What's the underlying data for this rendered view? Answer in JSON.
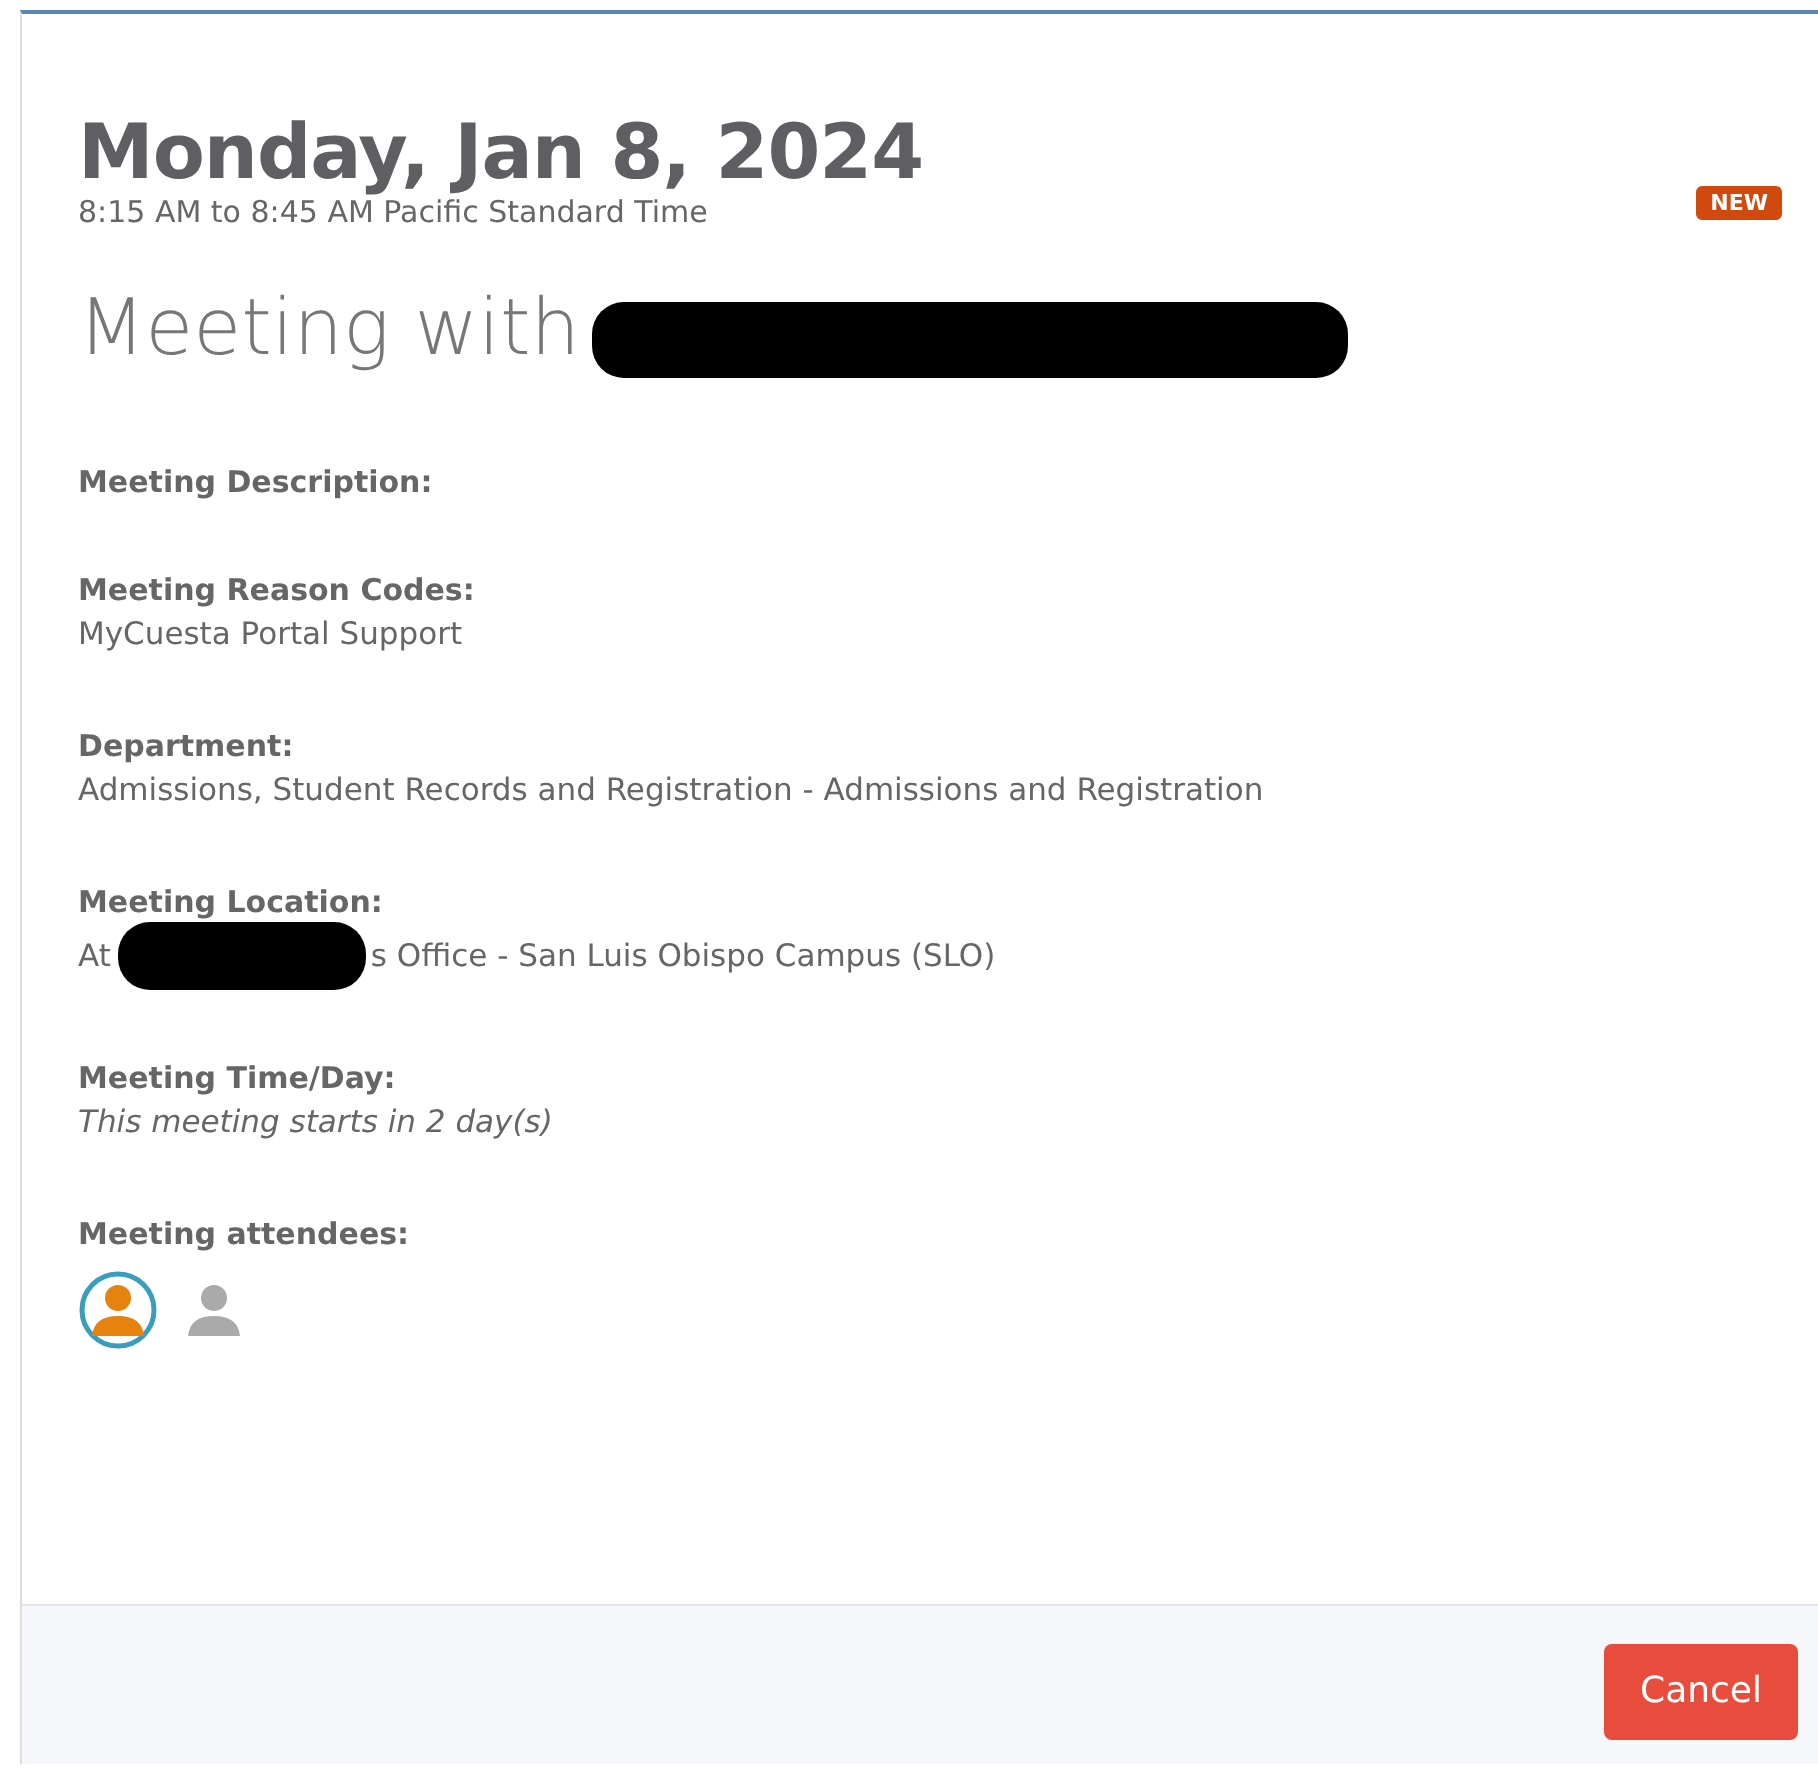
{
  "header": {
    "date": "Monday, Jan 8, 2024",
    "time_range": "8:15 AM to 8:45 AM Pacific Standard Time",
    "badge": "NEW"
  },
  "title": {
    "text": "Meeting with",
    "redacted": true
  },
  "fields": [
    {
      "kind": "empty",
      "label": "Meeting Description:"
    },
    {
      "kind": "text",
      "label": "Meeting Reason Codes:",
      "value": "MyCuesta Portal Support"
    },
    {
      "kind": "text",
      "label": "Department:",
      "value": "Admissions, Student Records and Registration - Admissions and Registration"
    },
    {
      "kind": "redacted",
      "label": "Meeting Location:",
      "value_before": "At",
      "value_after": "s Office - San Luis Obispo Campus (SLO)"
    },
    {
      "kind": "note",
      "label": "Meeting Time/Day:",
      "value": "This meeting starts in 2 day(s)"
    },
    {
      "kind": "attendees",
      "label": "Meeting attendees:",
      "attendees": [
        {
          "highlighted": true
        },
        {
          "highlighted": false
        }
      ]
    }
  ],
  "footer": {
    "buttons": [
      "Cancel"
    ]
  }
}
